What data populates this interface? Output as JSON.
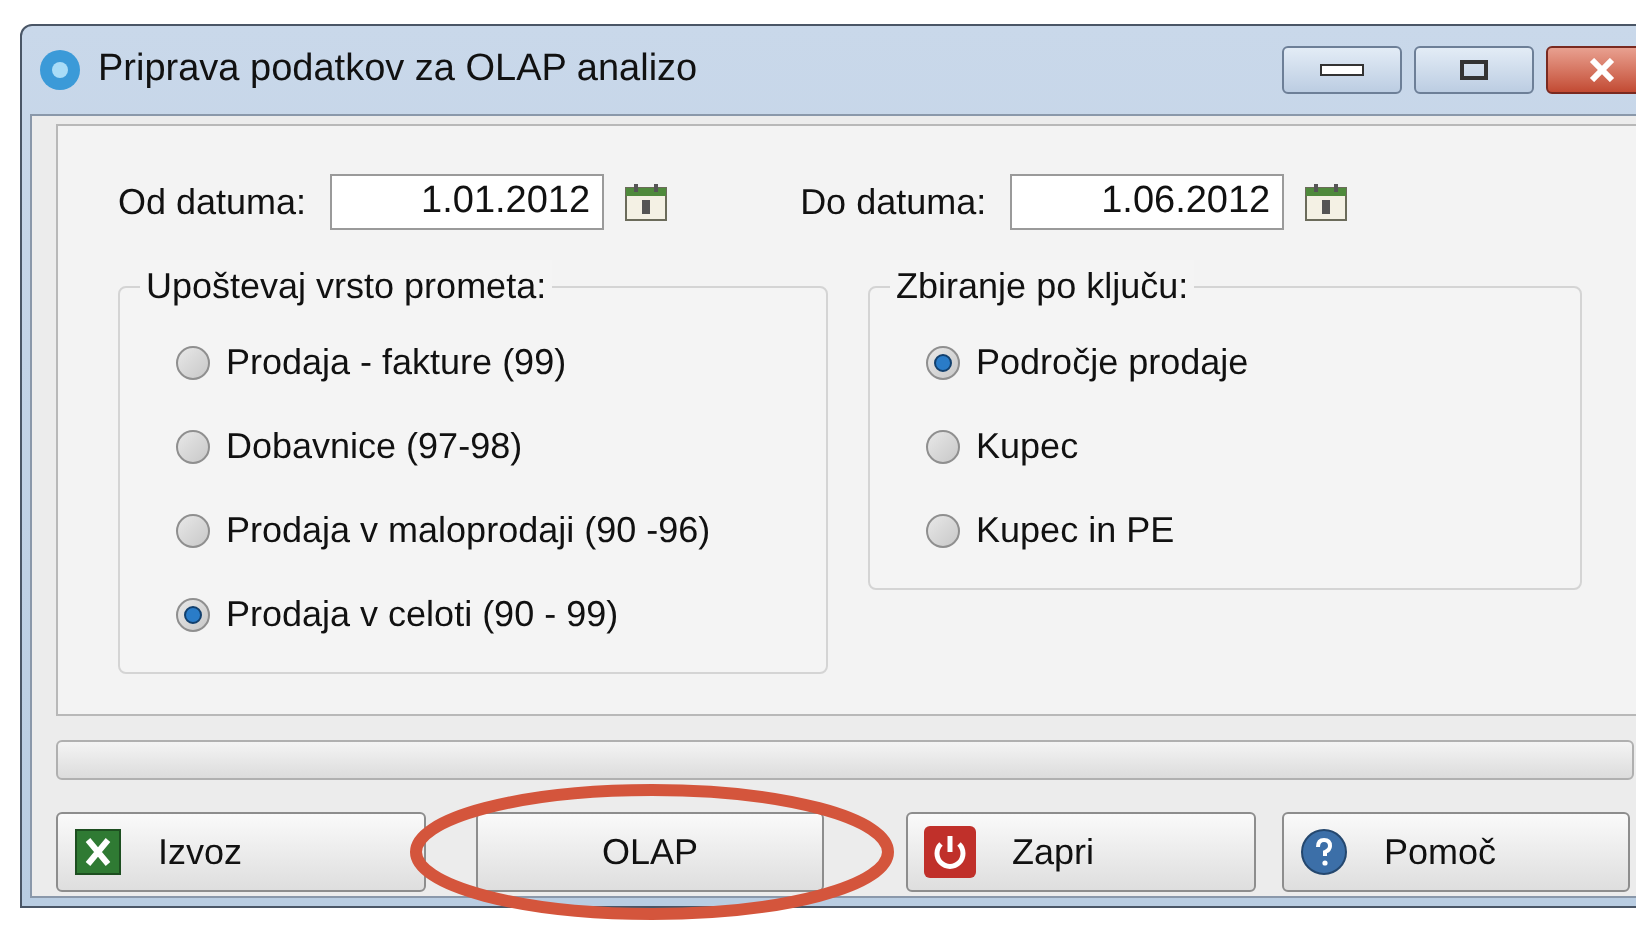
{
  "window": {
    "title": "Priprava podatkov za OLAP analizo"
  },
  "date_from": {
    "label": "Od datuma:",
    "value": "1.01.2012"
  },
  "date_to": {
    "label": "Do datuma:",
    "value": "1.06.2012"
  },
  "traffic_group": {
    "title": "Upoštevaj vrsto prometa:",
    "options": [
      {
        "label": "Prodaja - fakture (99)",
        "selected": false
      },
      {
        "label": "Dobavnice (97-98)",
        "selected": false
      },
      {
        "label": "Prodaja v maloprodaji (90 -96)",
        "selected": false
      },
      {
        "label": "Prodaja v celoti (90 - 99)",
        "selected": true
      }
    ]
  },
  "key_group": {
    "title": "Zbiranje po ključu:",
    "options": [
      {
        "label": "Področje prodaje",
        "selected": true
      },
      {
        "label": "Kupec",
        "selected": false
      },
      {
        "label": "Kupec in PE",
        "selected": false
      }
    ]
  },
  "progress": {
    "level": 0
  },
  "buttons": [
    {
      "label": "Izvoz",
      "kind": "excel"
    },
    {
      "label": "OLAP",
      "kind": "plain",
      "highlighted": true
    },
    {
      "label": "Zapri",
      "kind": "power"
    },
    {
      "label": "Pomoč",
      "kind": "help"
    }
  ]
}
